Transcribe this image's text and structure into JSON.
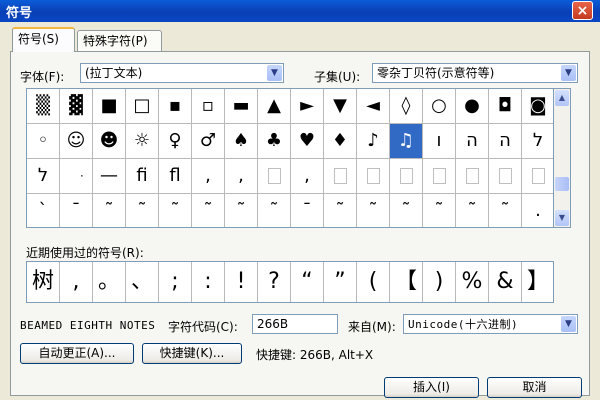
{
  "window": {
    "title": "符号",
    "close_label": "×"
  },
  "tabs": [
    {
      "label": "符号(S)",
      "active": true
    },
    {
      "label": "特殊字符(P)",
      "active": false
    }
  ],
  "font": {
    "label": "字体(F):",
    "value": "(拉丁文本)"
  },
  "subset": {
    "label": "子集(U):",
    "value": "零杂丁贝符(示意符等)"
  },
  "symbols": [
    [
      "▒",
      "▓",
      "■",
      "□",
      "▪",
      "▫",
      "▬",
      "▲",
      "►",
      "▼",
      "◄",
      "◊",
      "○",
      "●",
      "◘",
      "◙"
    ],
    [
      "◦",
      "☺",
      "☻",
      "☼",
      "♀",
      "♂",
      "♠",
      "♣",
      "♥",
      "♦",
      "♪",
      "♫",
      "ו",
      "ה",
      "ה",
      "ל"
    ],
    [
      "ל",
      "ּ",
      "—",
      "ﬁ",
      "ﬂ",
      ",",
      ",",
      "",
      ",",
      "",
      "",
      "",
      "",
      "",
      "",
      ""
    ],
    [
      "ˋ",
      "ˉ",
      "˜",
      "˜",
      "˜",
      "˜",
      "˜",
      "˜",
      "ˉ",
      "˜",
      "˜",
      "˜",
      "˜",
      "˜",
      "˜",
      "."
    ]
  ],
  "selected_symbol": "♫",
  "recent": {
    "label": "近期使用过的符号(R):",
    "items": [
      "树",
      ",",
      "。",
      "、",
      ";",
      ":",
      "!",
      "?",
      "“",
      "”",
      "(",
      "【",
      ")",
      "%",
      "&",
      "】"
    ]
  },
  "char_name": "BEAMED EIGHTH NOTES",
  "char_code": {
    "label": "字符代码(C):",
    "value": "266B"
  },
  "from": {
    "label": "来自(M):",
    "value": "Unicode(十六进制)"
  },
  "buttons": {
    "autocorrect": "自动更正(A)...",
    "shortcut_key": "快捷键(K)...",
    "insert": "插入(I)",
    "cancel": "取消"
  },
  "shortcut_text": "快捷键: 266B, Alt+X"
}
